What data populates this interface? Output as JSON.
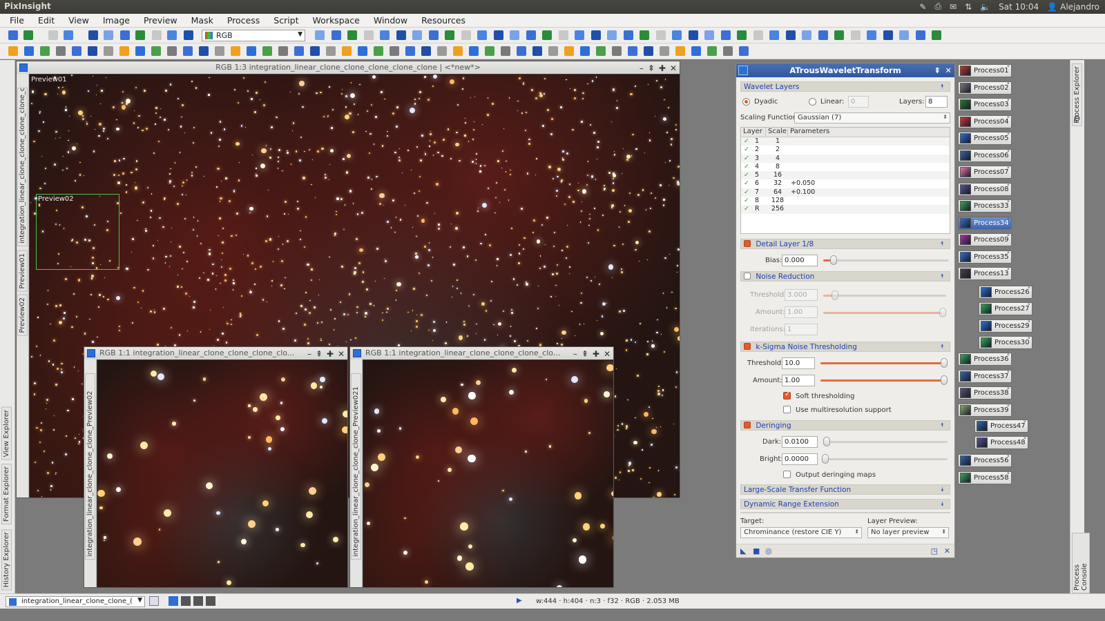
{
  "topbar": {
    "app": "PixInsight",
    "time": "Sat 10:04",
    "user": "Alejandro"
  },
  "menu": [
    "File",
    "Edit",
    "View",
    "Image",
    "Preview",
    "Mask",
    "Process",
    "Script",
    "Workspace",
    "Window",
    "Resources"
  ],
  "toolbar": {
    "channel_select": "RGB"
  },
  "main_window": {
    "title": "RGB 1:3 integration_linear_clone_clone_clone_clone_clone | <*new*>",
    "preview1_label": "Preview01",
    "preview2_label": "Preview02",
    "side_tabs": [
      "integration_linear_clone_clone_clone_clone_clone",
      "Preview01",
      "Preview02"
    ]
  },
  "preview_window_1": {
    "title": "RGB 1:1 integration_linear_clone_clone_clone_clo...",
    "side": "integration_linear_clone_clone_clone_Preview02"
  },
  "preview_window_2": {
    "title": "RGB 1:1 integration_linear_clone_clone_clone_clo...",
    "side": "integration_linear_clone_clone_clone_Preview021"
  },
  "atw": {
    "title": "ATrousWaveletTransform",
    "wavelet_layers": "Wavelet Layers",
    "dyadic": "Dyadic",
    "linear": "Linear:",
    "linear_value": "0",
    "layers_label": "Layers:",
    "layers_value": "8",
    "scaling_label": "Scaling Function:",
    "scaling_value": "Gaussian (7)",
    "table_headers": [
      "Layer",
      "Scale",
      "Parameters"
    ],
    "rows": [
      [
        "1",
        "1",
        ""
      ],
      [
        "2",
        "2",
        ""
      ],
      [
        "3",
        "4",
        ""
      ],
      [
        "4",
        "8",
        ""
      ],
      [
        "5",
        "16",
        ""
      ],
      [
        "6",
        "32",
        "+0.050"
      ],
      [
        "7",
        "64",
        "+0.100"
      ],
      [
        "8",
        "128",
        ""
      ],
      [
        "R",
        "256",
        ""
      ]
    ],
    "detail_layer": "Detail Layer 1/8",
    "bias_label": "Bias:",
    "bias_value": "0.000",
    "noise_reduction": "Noise Reduction",
    "nr_threshold_label": "Threshold:",
    "nr_threshold": "3.000",
    "nr_amount_label": "Amount:",
    "nr_amount": "1.00",
    "nr_iter_label": "Iterations:",
    "nr_iter": "1",
    "ksigma": "k-Sigma Noise Thresholding",
    "ks_threshold_label": "Threshold:",
    "ks_threshold": "10.0",
    "ks_amount_label": "Amount:",
    "ks_amount": "1.00",
    "soft": "Soft thresholding",
    "multires": "Use multiresolution support",
    "deringing": "Deringing",
    "dark_label": "Dark:",
    "dark": "0.0100",
    "bright_label": "Bright:",
    "bright": "0.0000",
    "output_maps": "Output deringing maps",
    "lstf": "Large-Scale Transfer Function",
    "dre": "Dynamic Range Extension",
    "target_label": "Target:",
    "target_value": "Chrominance (restore CIE Y)",
    "layer_preview_label": "Layer Preview:",
    "layer_preview_value": "No layer preview"
  },
  "processes": [
    "Process01",
    "Process02",
    "Process03",
    "Process04",
    "Process05",
    "Process06",
    "Process07",
    "Process08",
    "Process33",
    "Process34",
    "Process09",
    "Process35",
    "Process13",
    "Process26",
    "Process27",
    "Process29",
    "Process30",
    "Process36",
    "Process37",
    "Process38",
    "Process39",
    "Process47",
    "Process48",
    "Process56",
    "Process58"
  ],
  "left_explorers": [
    "View Explorer",
    "Format Explorer",
    "History Explorer"
  ],
  "right_explorers": [
    "Process Explorer",
    "Process Console"
  ],
  "status": {
    "view": "integration_linear_clone_clone_(",
    "info": "w:444 · h:404 · n:3 · f32 · RGB · 2.053 MB"
  }
}
